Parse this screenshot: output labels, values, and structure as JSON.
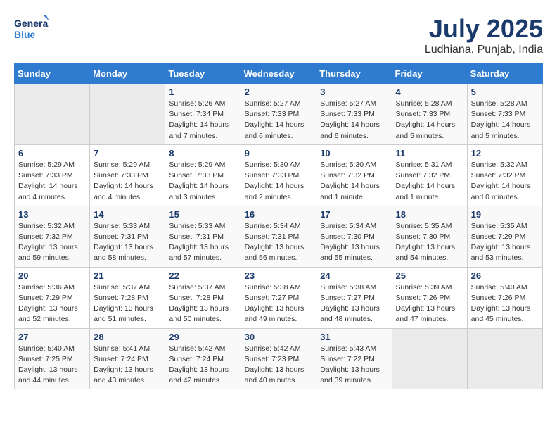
{
  "header": {
    "logo_general": "General",
    "logo_blue": "Blue",
    "month_year": "July 2025",
    "location": "Ludhiana, Punjab, India"
  },
  "days_of_week": [
    "Sunday",
    "Monday",
    "Tuesday",
    "Wednesday",
    "Thursday",
    "Friday",
    "Saturday"
  ],
  "weeks": [
    [
      {
        "day": "",
        "info": ""
      },
      {
        "day": "",
        "info": ""
      },
      {
        "day": "1",
        "info": "Sunrise: 5:26 AM\nSunset: 7:34 PM\nDaylight: 14 hours and 7 minutes."
      },
      {
        "day": "2",
        "info": "Sunrise: 5:27 AM\nSunset: 7:33 PM\nDaylight: 14 hours and 6 minutes."
      },
      {
        "day": "3",
        "info": "Sunrise: 5:27 AM\nSunset: 7:33 PM\nDaylight: 14 hours and 6 minutes."
      },
      {
        "day": "4",
        "info": "Sunrise: 5:28 AM\nSunset: 7:33 PM\nDaylight: 14 hours and 5 minutes."
      },
      {
        "day": "5",
        "info": "Sunrise: 5:28 AM\nSunset: 7:33 PM\nDaylight: 14 hours and 5 minutes."
      }
    ],
    [
      {
        "day": "6",
        "info": "Sunrise: 5:29 AM\nSunset: 7:33 PM\nDaylight: 14 hours and 4 minutes."
      },
      {
        "day": "7",
        "info": "Sunrise: 5:29 AM\nSunset: 7:33 PM\nDaylight: 14 hours and 4 minutes."
      },
      {
        "day": "8",
        "info": "Sunrise: 5:29 AM\nSunset: 7:33 PM\nDaylight: 14 hours and 3 minutes."
      },
      {
        "day": "9",
        "info": "Sunrise: 5:30 AM\nSunset: 7:33 PM\nDaylight: 14 hours and 2 minutes."
      },
      {
        "day": "10",
        "info": "Sunrise: 5:30 AM\nSunset: 7:32 PM\nDaylight: 14 hours and 1 minute."
      },
      {
        "day": "11",
        "info": "Sunrise: 5:31 AM\nSunset: 7:32 PM\nDaylight: 14 hours and 1 minute."
      },
      {
        "day": "12",
        "info": "Sunrise: 5:32 AM\nSunset: 7:32 PM\nDaylight: 14 hours and 0 minutes."
      }
    ],
    [
      {
        "day": "13",
        "info": "Sunrise: 5:32 AM\nSunset: 7:32 PM\nDaylight: 13 hours and 59 minutes."
      },
      {
        "day": "14",
        "info": "Sunrise: 5:33 AM\nSunset: 7:31 PM\nDaylight: 13 hours and 58 minutes."
      },
      {
        "day": "15",
        "info": "Sunrise: 5:33 AM\nSunset: 7:31 PM\nDaylight: 13 hours and 57 minutes."
      },
      {
        "day": "16",
        "info": "Sunrise: 5:34 AM\nSunset: 7:31 PM\nDaylight: 13 hours and 56 minutes."
      },
      {
        "day": "17",
        "info": "Sunrise: 5:34 AM\nSunset: 7:30 PM\nDaylight: 13 hours and 55 minutes."
      },
      {
        "day": "18",
        "info": "Sunrise: 5:35 AM\nSunset: 7:30 PM\nDaylight: 13 hours and 54 minutes."
      },
      {
        "day": "19",
        "info": "Sunrise: 5:35 AM\nSunset: 7:29 PM\nDaylight: 13 hours and 53 minutes."
      }
    ],
    [
      {
        "day": "20",
        "info": "Sunrise: 5:36 AM\nSunset: 7:29 PM\nDaylight: 13 hours and 52 minutes."
      },
      {
        "day": "21",
        "info": "Sunrise: 5:37 AM\nSunset: 7:28 PM\nDaylight: 13 hours and 51 minutes."
      },
      {
        "day": "22",
        "info": "Sunrise: 5:37 AM\nSunset: 7:28 PM\nDaylight: 13 hours and 50 minutes."
      },
      {
        "day": "23",
        "info": "Sunrise: 5:38 AM\nSunset: 7:27 PM\nDaylight: 13 hours and 49 minutes."
      },
      {
        "day": "24",
        "info": "Sunrise: 5:38 AM\nSunset: 7:27 PM\nDaylight: 13 hours and 48 minutes."
      },
      {
        "day": "25",
        "info": "Sunrise: 5:39 AM\nSunset: 7:26 PM\nDaylight: 13 hours and 47 minutes."
      },
      {
        "day": "26",
        "info": "Sunrise: 5:40 AM\nSunset: 7:26 PM\nDaylight: 13 hours and 45 minutes."
      }
    ],
    [
      {
        "day": "27",
        "info": "Sunrise: 5:40 AM\nSunset: 7:25 PM\nDaylight: 13 hours and 44 minutes."
      },
      {
        "day": "28",
        "info": "Sunrise: 5:41 AM\nSunset: 7:24 PM\nDaylight: 13 hours and 43 minutes."
      },
      {
        "day": "29",
        "info": "Sunrise: 5:42 AM\nSunset: 7:24 PM\nDaylight: 13 hours and 42 minutes."
      },
      {
        "day": "30",
        "info": "Sunrise: 5:42 AM\nSunset: 7:23 PM\nDaylight: 13 hours and 40 minutes."
      },
      {
        "day": "31",
        "info": "Sunrise: 5:43 AM\nSunset: 7:22 PM\nDaylight: 13 hours and 39 minutes."
      },
      {
        "day": "",
        "info": ""
      },
      {
        "day": "",
        "info": ""
      }
    ]
  ]
}
